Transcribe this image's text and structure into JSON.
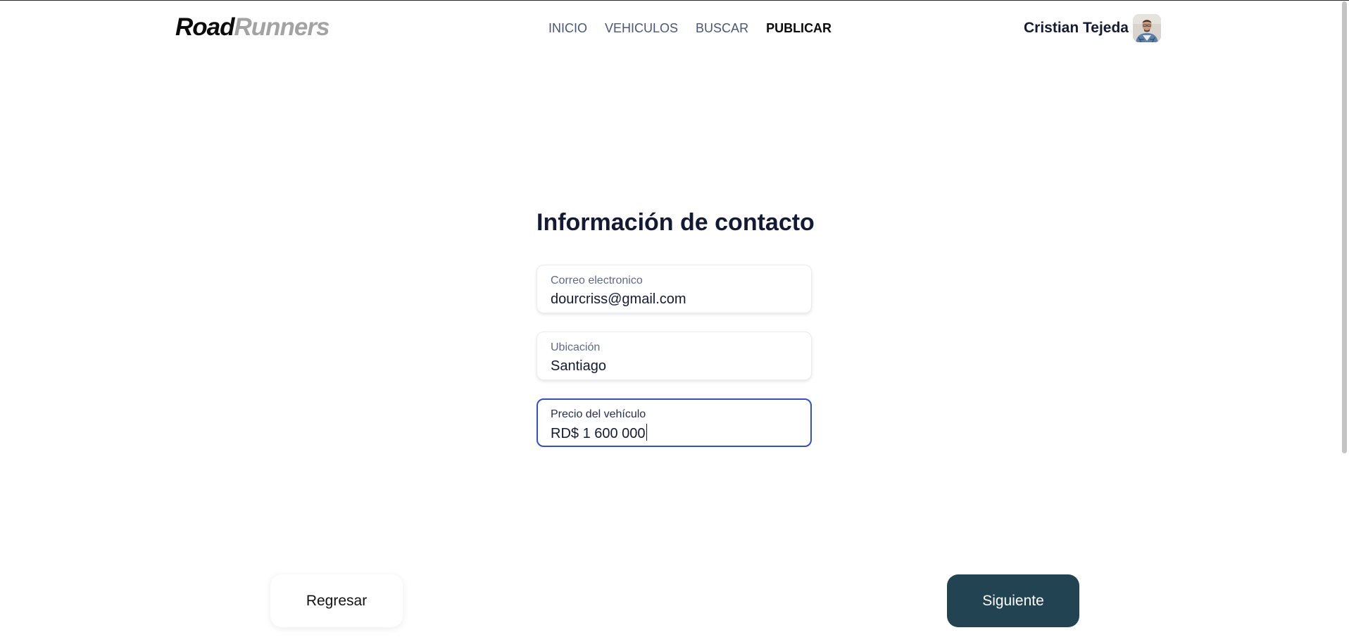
{
  "header": {
    "logo": {
      "part1": "Road",
      "part2": "Runners"
    },
    "nav": [
      {
        "label": "INICIO",
        "active": false
      },
      {
        "label": "VEHICULOS",
        "active": false
      },
      {
        "label": "BUSCAR",
        "active": false
      },
      {
        "label": "PUBLICAR",
        "active": true
      }
    ],
    "user": {
      "name": "Cristian Tejeda",
      "avatar_icon": "user-avatar-photo"
    }
  },
  "form": {
    "title": "Información de contacto",
    "fields": [
      {
        "label": "Correo electronico",
        "value": "dourcriss@gmail.com",
        "focused": false
      },
      {
        "label": "Ubicación",
        "value": "Santiago",
        "focused": false
      },
      {
        "label": "Precio del vehículo",
        "value": "RD$ 1 600 000",
        "focused": true
      }
    ]
  },
  "actions": {
    "back_label": "Regresar",
    "next_label": "Siguiente"
  },
  "colors": {
    "accent_focus": "#3150c2",
    "primary_button": "#224452",
    "logo_secondary": "#a3a3a3",
    "title_text": "#141a33"
  }
}
